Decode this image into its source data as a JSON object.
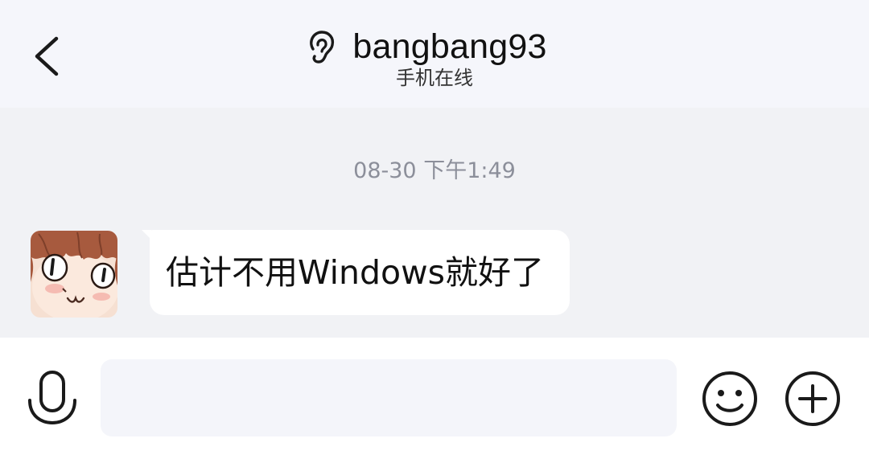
{
  "header": {
    "back_icon": "chevron-left-icon",
    "ear_icon": "ear-icon",
    "title": "bangbang93",
    "subtitle": "手机在线"
  },
  "chat": {
    "timestamp": "08-30 下午1:49",
    "messages": [
      {
        "sender": "other",
        "avatar_icon": "anime-avatar",
        "text": "估计不用Windows就好了"
      }
    ]
  },
  "input_bar": {
    "voice_icon": "microphone-icon",
    "input_value": "",
    "input_placeholder": "",
    "emoji_icon": "smiley-icon",
    "more_icon": "plus-circle-icon"
  },
  "colors": {
    "header_bg": "#f5f6fb",
    "chat_bg": "#f1f2f5",
    "bubble_bg": "#ffffff",
    "input_bg": "#f4f5fa",
    "timestamp_text": "#8c8f9a"
  }
}
